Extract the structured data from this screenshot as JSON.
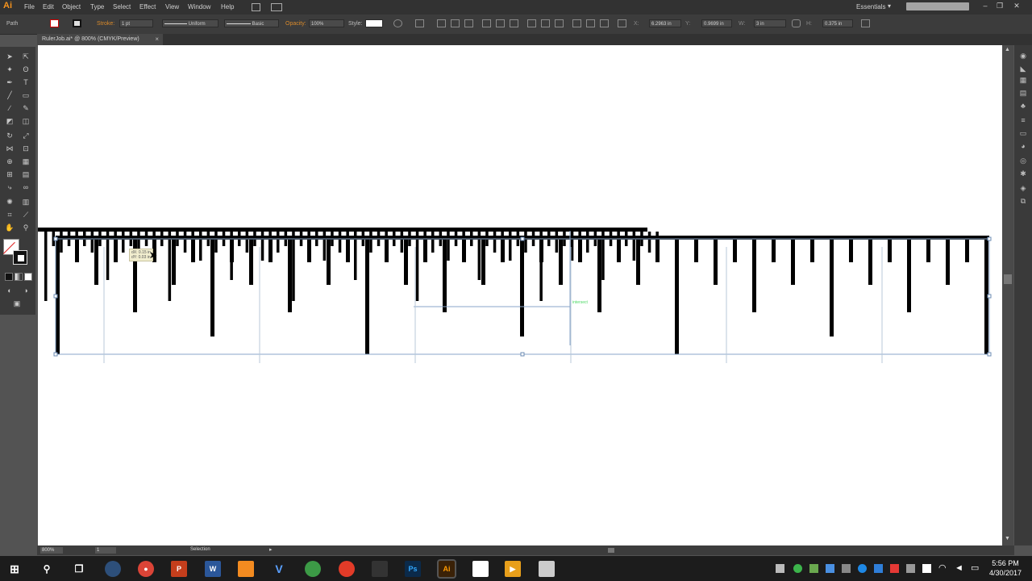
{
  "app": {
    "logo": "Ai"
  },
  "menu": [
    "File",
    "Edit",
    "Object",
    "Type",
    "Select",
    "Effect",
    "View",
    "Window",
    "Help"
  ],
  "workspace": "Essentials",
  "control": {
    "selection_type": "Path",
    "stroke_label": "Stroke:",
    "stroke_weight": "1 pt",
    "profile_uniform": "Uniform",
    "brush_basic": "Basic",
    "opacity_label": "Opacity:",
    "opacity_value": "100%",
    "style_label": "Style:",
    "x_label": "X:",
    "x_value": "6.2963 in",
    "y_label": "Y:",
    "y_value": "0.9699 in",
    "w_label": "W:",
    "w_value": "3 in",
    "h_label": "H:",
    "h_value": "0.375 in"
  },
  "document_tab": {
    "title": "RulerJob.ai* @ 800% (CMYK/Preview)",
    "close": "×"
  },
  "status": {
    "zoom": "800%",
    "page": "1",
    "tool": "Selection"
  },
  "canvas": {
    "tooltip_line1": "dX: 0.15 in",
    "tooltip_line2": "dY: 0.03 in",
    "smart_guide": "intersect"
  },
  "taskbar": {
    "time": "5:56 PM",
    "date": "4/30/2017"
  },
  "colors": {
    "illustrator_orange": "#f7941d",
    "canvas": "#ffffff",
    "ui_dark": "#323232",
    "smart_guide_green": "#4cd964"
  }
}
